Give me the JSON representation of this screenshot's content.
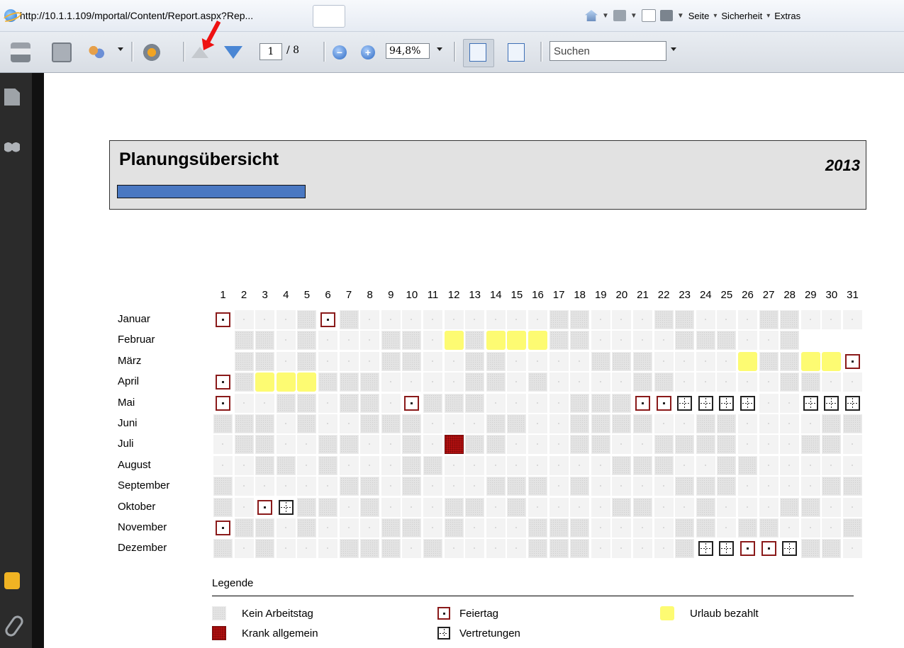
{
  "browser": {
    "tab_title": "http://10.1.1.109/mportal/Content/Report.aspx?Rep...",
    "commands": [
      "Seite",
      "Sicherheit",
      "Extras"
    ]
  },
  "toolbar": {
    "current_page": "1",
    "page_total": "/ 8",
    "zoom": "94,8%",
    "search_placeholder": "Suchen"
  },
  "report": {
    "title": "Planungsübersicht",
    "year": "2013"
  },
  "calendar": {
    "days": [
      "1",
      "2",
      "3",
      "4",
      "5",
      "6",
      "7",
      "8",
      "9",
      "10",
      "11",
      "12",
      "13",
      "14",
      "15",
      "16",
      "17",
      "18",
      "19",
      "20",
      "21",
      "22",
      "23",
      "24",
      "25",
      "26",
      "27",
      "28",
      "29",
      "30",
      "31"
    ],
    "months": [
      {
        "name": "Januar",
        "cells": "HwwwoHowwwwwwwwwoowwwoowwwoowww"
      },
      {
        "name": "Februar",
        "cells": "xoowowwwoowVoVVVoowwwwooowwoxxx"
      },
      {
        "name": "März",
        "cells": "xoowowwwoowwoowwwwooowwwwVooVVHwH"
      },
      {
        "name": "April",
        "cells": "HoVVVooowwwwoowowwwwoowwwwwoowwx"
      },
      {
        "name": "Mai",
        "cells": "HwwoowoowHooowwwwoooHHSSSSwwSSSHS"
      },
      {
        "name": "Juni",
        "cells": "ooowowwooowwwoowwoooowwoowwwwoox"
      },
      {
        "name": "Juli",
        "cells": "woowwoowwowKoowwwoowwoooowwwoowww"
      },
      {
        "name": "August",
        "cells": "wwoowowwwoowwwwwwwwooowwoowwwwwwo"
      },
      {
        "name": "September",
        "cells": "owwwwwoowowwwooowowwwwooowwwwooox"
      },
      {
        "name": "Oktober",
        "cells": "owHSoowowwwoowowwwwoowwowwwoowwww"
      },
      {
        "name": "November",
        "cells": "Hoowowwwoowowwwooowwwwoowoowwwowx"
      },
      {
        "name": "Dezember",
        "cells": "owowwwooowowwwwooowwwwoSSHHSoowwo"
      }
    ]
  },
  "legend": {
    "title": "Legende",
    "items": {
      "off": "Kein Arbeitstag",
      "holiday": "Feiertag",
      "vacation": "Urlaub bezahlt",
      "sick": "Krank allgemein",
      "substitution": "Vertretungen"
    }
  },
  "colors": {
    "vacation": "#fdfb72",
    "sick": "#b41010",
    "holiday_border": "#8a1a1a",
    "header_bar": "#4a78c2"
  }
}
